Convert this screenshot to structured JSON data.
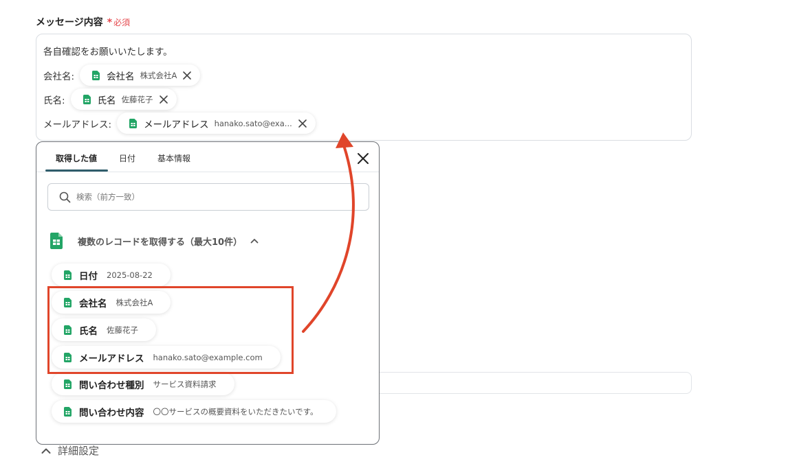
{
  "field": {
    "label": "メッセージ内容",
    "required_mark": "*",
    "required_text": "必須"
  },
  "message": {
    "intro": "各自確認をお願いいたします。",
    "lines": [
      {
        "label": "会社名:",
        "token_name": "会社名",
        "token_value": "株式会社A"
      },
      {
        "label": "氏名:",
        "token_name": "氏名",
        "token_value": "佐藤花子"
      },
      {
        "label": "メールアドレス:",
        "token_name": "メールアドレス",
        "token_value": "hanako.sato@exa..."
      }
    ]
  },
  "popup": {
    "tabs": [
      "取得した値",
      "日付",
      "基本情報"
    ],
    "active_tab": "取得した値",
    "search_placeholder": "検索（前方一致）",
    "group_title": "複数のレコードを取得する（最大10件）",
    "items": [
      {
        "name": "日付",
        "value": "2025-08-22"
      },
      {
        "name": "会社名",
        "value": "株式会社A"
      },
      {
        "name": "氏名",
        "value": "佐藤花子"
      },
      {
        "name": "メールアドレス",
        "value": "hanako.sato@example.com"
      },
      {
        "name": "問い合わせ種別",
        "value": "サービス資料請求"
      },
      {
        "name": "問い合わせ内容",
        "value": "〇〇サービスの概要資料をいただきたいです。"
      }
    ]
  },
  "advanced": {
    "label": "詳細設定"
  },
  "colors": {
    "accent": "#2f5d6b",
    "required": "#e5484d",
    "highlight": "#e0452a",
    "sheet_green": "#23a566"
  },
  "icons": [
    "sheets-icon",
    "close-icon",
    "search-icon",
    "chevron-up-icon",
    "remove-token-icon"
  ]
}
